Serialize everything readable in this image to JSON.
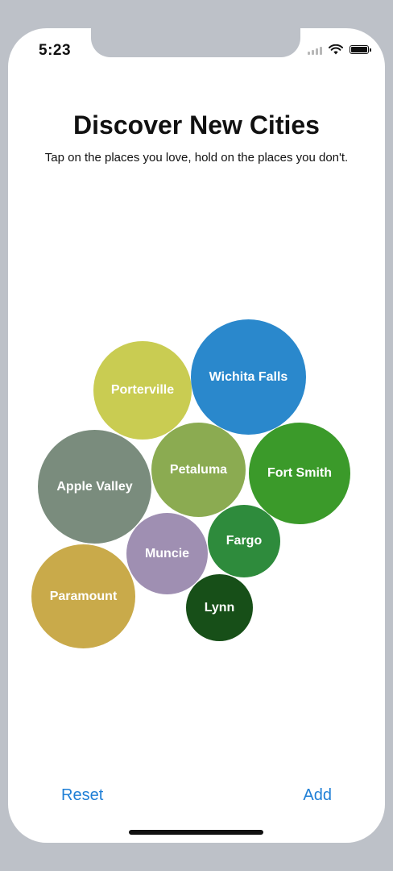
{
  "status_bar": {
    "time": "5:23"
  },
  "header": {
    "title": "Discover New Cities",
    "subtitle": "Tap on the places you love, hold on the places you don't."
  },
  "cities": [
    {
      "name": "Porterville",
      "color": "#c9cc52"
    },
    {
      "name": "Wichita Falls",
      "color": "#2a88cc"
    },
    {
      "name": "Apple Valley",
      "color": "#7a8c7d"
    },
    {
      "name": "Petaluma",
      "color": "#8bab51"
    },
    {
      "name": "Fort Smith",
      "color": "#3b9a2a"
    },
    {
      "name": "Muncie",
      "color": "#9f8fb2"
    },
    {
      "name": "Fargo",
      "color": "#2e8b3c"
    },
    {
      "name": "Paramount",
      "color": "#c9aa4a"
    },
    {
      "name": "Lynn",
      "color": "#174f18"
    }
  ],
  "actions": {
    "reset_label": "Reset",
    "add_label": "Add"
  },
  "colors": {
    "accent": "#1f7fd6",
    "frame": "#bdc1c8"
  }
}
